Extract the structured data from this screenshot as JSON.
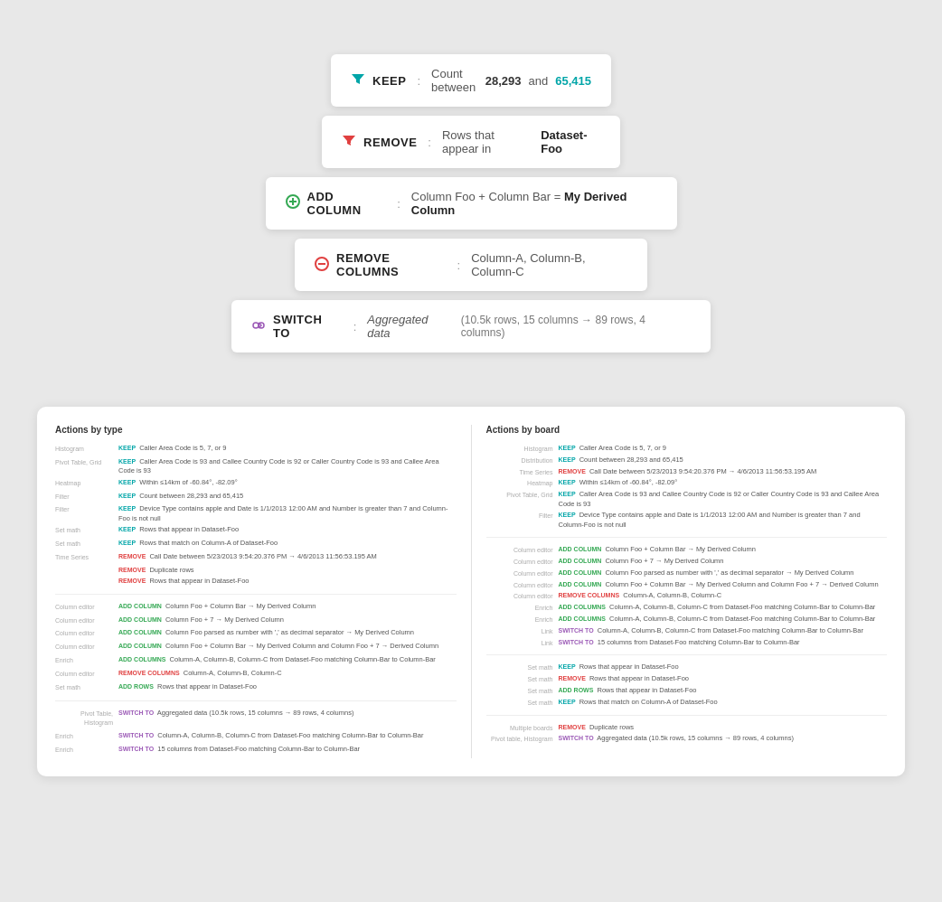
{
  "cards": [
    {
      "id": "keep",
      "label": "KEEP",
      "colon": ":",
      "description": "Count between",
      "value1": "28,293",
      "and_text": "and",
      "value2": "65,415"
    },
    {
      "id": "remove",
      "label": "REMOVE",
      "colon": ":",
      "description": "Rows that appear in",
      "value": "Dataset-Foo"
    },
    {
      "id": "add_column",
      "label": "ADD COLUMN",
      "colon": ":",
      "expr": "Column Foo + Column Bar = My Derived Column"
    },
    {
      "id": "remove_columns",
      "label": "REMOVE COLUMNS",
      "colon": ":",
      "cols": "Column-A,  Column-B,  Column-C"
    },
    {
      "id": "switch_to",
      "label": "SWITCH TO",
      "colon": ":",
      "value": "Aggregated data",
      "detail": "(10.5k rows, 15 columns → 89 rows, 4 columns)"
    }
  ],
  "bottom": {
    "left_title": "Actions by type",
    "right_title": "Actions by board",
    "left_rows": [
      {
        "cat": "Histogram",
        "op": "KEEP",
        "text": "Caller Area Code is 5, 7, or 9"
      },
      {
        "cat": "Pivot Table, Grid",
        "op": "KEEP",
        "text": "Caller Area Code is 93 and Callee Country Code is 92  or  Caller Country Code is 93 and Callee Area Code is 93"
      },
      {
        "cat": "Heatmap",
        "op": "KEEP",
        "text": "Within ≤14km of -60.84°, -82.09°"
      },
      {
        "cat": "Filter",
        "op": "KEEP",
        "text": "Count between 28,293 and 65,415"
      },
      {
        "cat": "Filter",
        "op": "KEEP",
        "text": "Device Type contains apple  and  Date is 1/1/2013 12:00 AM  and  Number is greater than 7  and  Column-Foo is not null"
      },
      {
        "cat": "Set math",
        "op": "KEEP",
        "text": "Rows that appear in Dataset-Foo"
      },
      {
        "cat": "Set math",
        "op": "KEEP",
        "text": "Rows that match on Column-A  of  Dataset-Foo"
      },
      {
        "cat": "Time Series",
        "op": "REMOVE",
        "text": "Call Date between 5/23/2013 9:54:20.376 PM  ←  4/6/2013 11:56:53.195 AM"
      },
      {
        "cat": "",
        "op": "REMOVE",
        "text": "Duplicate rows"
      },
      {
        "cat": "",
        "op": "REMOVE",
        "text": "Rows that appear in Dataset-Foo"
      },
      {
        "cat": "Column editor",
        "op": "ADD COLUMN",
        "text": "Column Foo + Column Bar → My Derived Column"
      },
      {
        "cat": "Column editor",
        "op": "ADD COLUMN",
        "text": "Column Foo + 7 → My Derived Column"
      },
      {
        "cat": "Column editor",
        "op": "ADD COLUMN",
        "text": "Column Foo parsed as number with ',' as decimal separator → My Derived Column"
      },
      {
        "cat": "Column editor",
        "op": "ADD COLUMN",
        "text": "Column Foo + Column Bar → My Derived Column  and  Column Foo + 7 → Derived Column"
      },
      {
        "cat": "Enrich",
        "op": "ADD COLUMNS",
        "text": "Column-A, Column-B, Column-C from Dataset-Foo matching Column-Bar to Column-Bar"
      },
      {
        "cat": "Column editor",
        "op": "REMOVE COLUMNS",
        "text": "Column-A, Column-B, Column-C"
      },
      {
        "cat": "Set math",
        "op": "ADD ROWS",
        "text": "Rows that appear in Dataset-Foo"
      },
      {
        "cat": "",
        "op": "",
        "text": ""
      },
      {
        "cat": "Pivot Table, Histogram",
        "op": "SWITCH TO",
        "text": "Aggregated data (10.5k rows, 15 columns → 89 rows, 4 columns)"
      },
      {
        "cat": "Enrich",
        "op": "SWITCH TO",
        "text": "Column-A, Column-B, Column-C from Dataset-Foo matching Column-Bar to Column-Bar"
      },
      {
        "cat": "Enrich",
        "op": "SWITCH TO",
        "text": "15 columns from Dataset-Foo matching Column-Bar to Column-Bar"
      }
    ],
    "right_rows": [
      {
        "cat": "Histogram",
        "op": "KEEP",
        "text": "Caller Area Code is 5, 7, or 9"
      },
      {
        "cat": "Distribution",
        "op": "KEEP",
        "text": "Count between 28,293 and 65,415"
      },
      {
        "cat": "Time Series",
        "op": "REMOVE",
        "text": "Call Date between 5/23/2013 9:54:20.376 PM  ←  4/6/2013 11:56:53.195 AM"
      },
      {
        "cat": "Heatmap",
        "op": "KEEP",
        "text": "Within ≤14km of -60.84°, -82.09°"
      },
      {
        "cat": "Pivot Table, Grid",
        "op": "KEEP",
        "text": "Caller Area Code is 93 and Callee Country Code is 92  or  Caller Country Code is 93 and Callee Area Code is 93"
      },
      {
        "cat": "Filter",
        "op": "KEEP",
        "text": "Device Type contains apple  and  Date is 1/1/2013 12:00 AM  and  Number is greater than 7  and  Column-Foo is not null"
      },
      {
        "cat": "Column editor",
        "op": "ADD COLUMN",
        "text": "Column Foo + Column Bar → My Derived Column"
      },
      {
        "cat": "Column editor",
        "op": "ADD COLUMN",
        "text": "Column Foo + 7 → My Derived Column"
      },
      {
        "cat": "Column editor",
        "op": "ADD COLUMN",
        "text": "Column Foo parsed as number with ',' as decimal separator → My Derived Column"
      },
      {
        "cat": "Column editor",
        "op": "ADD COLUMN",
        "text": "Column Foo + Column Bar → My Derived Column  and  Column Foo + 7 → Derived Column"
      },
      {
        "cat": "Column editor",
        "op": "REMOVE COLUMNS",
        "text": "Column-A, Column-B, Column-C"
      },
      {
        "cat": "Enrich",
        "op": "ADD COLUMNS",
        "text": "Column-A, Column-B, Column-C from Dataset-Foo matching Column-Bar to Column-Bar"
      },
      {
        "cat": "Enrich",
        "op": "ADD COLUMNS",
        "text": "Column-A, Column-B, Column-C from Dataset-Foo matching Column-Bar to Column-Bar"
      },
      {
        "cat": "Link",
        "op": "SWITCH TO",
        "text": "Column-A, Column-B, Column-C from Dataset-Foo matching Column-Bar to Column-Bar"
      },
      {
        "cat": "Link",
        "op": "SWITCH TO",
        "text": "15 columns from Dataset-Foo matching Column-Bar to Column-Bar"
      },
      {
        "cat": "Set math",
        "op": "KEEP",
        "text": "Rows that appear in Dataset-Foo"
      },
      {
        "cat": "Set math",
        "op": "REMOVE",
        "text": "Rows that appear in Dataset-Foo"
      },
      {
        "cat": "Set math",
        "op": "ADD ROWS",
        "text": "Rows that appear in Dataset-Foo"
      },
      {
        "cat": "Set math",
        "op": "KEEP",
        "text": "Rows that match on Column-A  of  Dataset-Foo"
      },
      {
        "cat": "Multiple boards",
        "op": "REMOVE",
        "text": "Duplicate rows"
      },
      {
        "cat": "Pivot table, Histogram",
        "op": "SWITCH TO",
        "text": "Aggregated data (10.5k rows, 15 columns → 89 rows, 4 columns)"
      }
    ]
  }
}
